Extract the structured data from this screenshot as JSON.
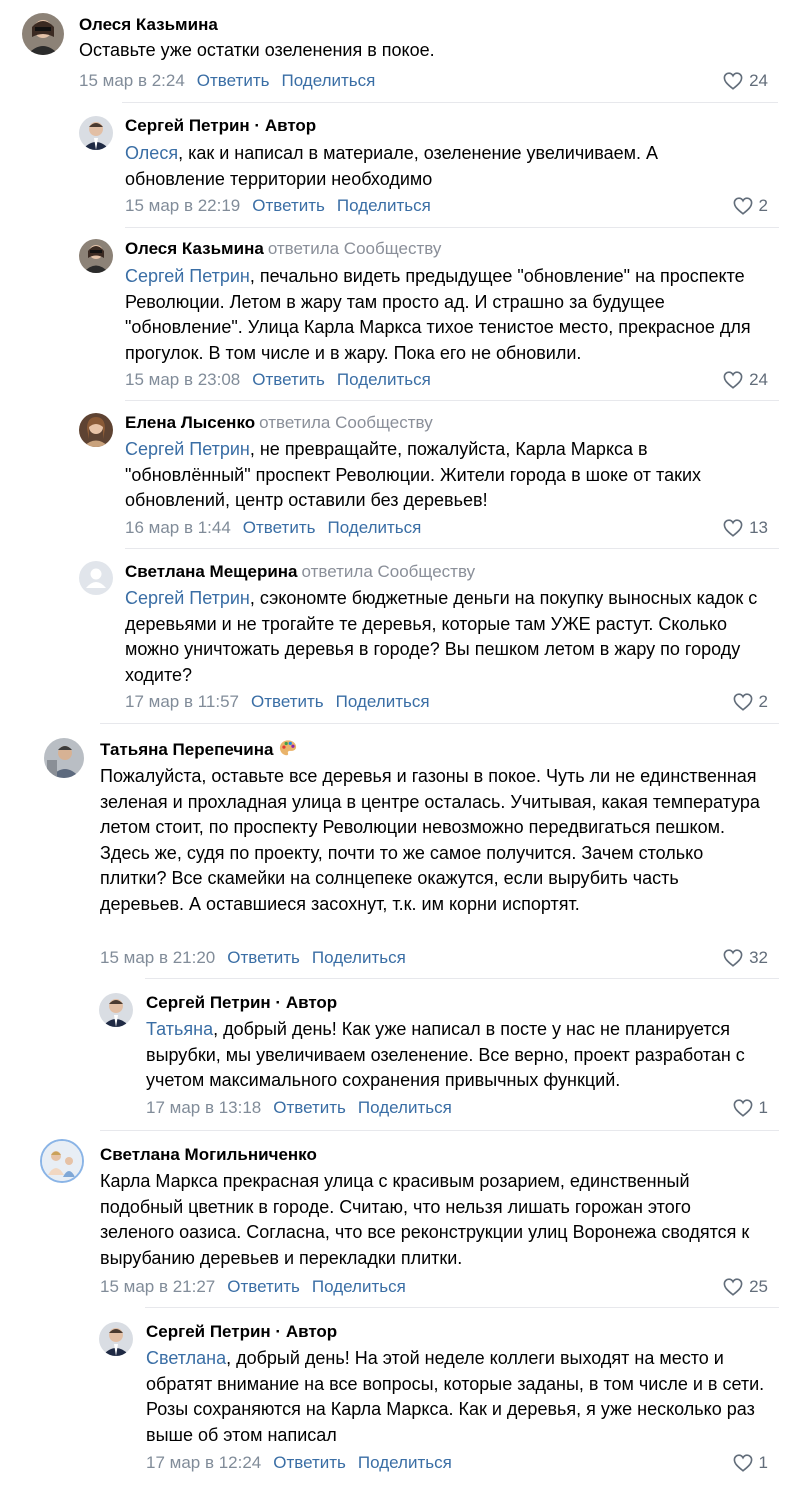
{
  "colors": {
    "link": "#3a6ea5",
    "muted": "#818c99",
    "divider": "#e7e8ec"
  },
  "comments": [
    {
      "author": "Олеся Казьмина",
      "text": "Оставьте уже остатки озеленения в покое.",
      "date": "15 мар в 2:24",
      "reply": "Ответить",
      "share": "Поделиться",
      "likes": "24"
    },
    {
      "author": "Сергей Петрин",
      "role": "Автор",
      "mention": "Олеся",
      "text": ", как и написал в материале, озеленение увеличиваем. А обновление территории необходимо",
      "date": "15 мар в 22:19",
      "reply": "Ответить",
      "share": "Поделиться",
      "likes": "2"
    },
    {
      "author": "Олеся Казьмина",
      "replied_to": "ответила Сообществу",
      "mention": "Сергей Петрин",
      "text": ", печально видеть предыдущее \"обновление\" на проспекте Революции. Летом в жару там просто ад. И страшно за будущее \"обновление\". Улица Карла Маркса тихое тенистое место, прекрасное для прогулок. В том числе и в жару. Пока его не обновили.",
      "date": "15 мар в 23:08",
      "reply": "Ответить",
      "share": "Поделиться",
      "likes": "24"
    },
    {
      "author": "Елена Лысенко",
      "replied_to": "ответила Сообществу",
      "mention": "Сергей Петрин",
      "text": ", не превращайте, пожалуйста, Карла Маркса в \"обновлённый\" проспект Революции. Жители города в шоке от таких обновлений, центр оставили без деревьев!",
      "date": "16 мар в 1:44",
      "reply": "Ответить",
      "share": "Поделиться",
      "likes": "13"
    },
    {
      "author": "Светлана Мещерина",
      "replied_to": "ответила Сообществу",
      "mention": "Сергей Петрин",
      "text": ", сэкономте бюджетные деньги на покупку выносных кадок с деревьями и не трогайте те деревья, которые там УЖЕ растут. Сколько можно уничтожать деревья в городе? Вы пешком летом в жару по городу ходите?",
      "date": "17 мар в 11:57",
      "reply": "Ответить",
      "share": "Поделиться",
      "likes": "2"
    },
    {
      "author": "Татьяна Перепечина",
      "text": "Пожалуйста, оставьте все деревья и газоны в покое. Чуть ли не единственная зеленая и прохладная улица в центре осталась. Учитывая, какая температура летом стоит, по проспекту Революции невозможно передвигаться пешком. Здесь же, судя по проекту, почти то же самое получится. Зачем столько плитки? Все скамейки на солнцепеке окажутся, если вырубить часть деревьев. А оставшиеся засохнут, т.к. им корни испортят.",
      "date": "15 мар в 21:20",
      "reply": "Ответить",
      "share": "Поделиться",
      "likes": "32"
    },
    {
      "author": "Сергей Петрин",
      "role": "Автор",
      "mention": "Татьяна",
      "text": ", добрый день! Как уже написал в посте у нас не планируется вырубки, мы увеличиваем озеленение. Все верно, проект разработан с учетом максимального сохранения привычных функций.",
      "date": "17 мар в 13:18",
      "reply": "Ответить",
      "share": "Поделиться",
      "likes": "1"
    },
    {
      "author": "Светлана Могильниченко",
      "text": "Карла Маркса прекрасная улица с красивым розарием, единственный подобный цветник в городе. Считаю, что нельзя лишать горожан этого зеленого оазиса. Согласна, что все реконструкции улиц Воронежа сводятся к вырубанию деревьев и перекладки плитки.",
      "date": "15 мар в 21:27",
      "reply": "Ответить",
      "share": "Поделиться",
      "likes": "25"
    },
    {
      "author": "Сергей Петрин",
      "role": "Автор",
      "mention": "Светлана",
      "text": ", добрый день! На этой неделе коллеги выходят на место и обратят внимание на все вопросы, которые заданы, в том числе и в сети. Розы сохраняются на Карла Маркса. Как и деревья, я уже несколько раз выше об этом написал",
      "date": "17 мар в 12:24",
      "reply": "Ответить",
      "share": "Поделиться",
      "likes": "1"
    }
  ]
}
